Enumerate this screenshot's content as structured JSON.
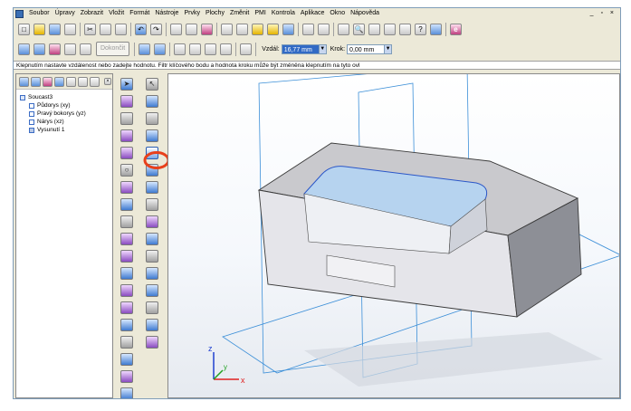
{
  "menu": {
    "items": [
      "Soubor",
      "Úpravy",
      "Zobrazit",
      "Vložit",
      "Formát",
      "Nástroje",
      "Prvky",
      "Plochy",
      "Změnit",
      "PMI",
      "Kontrola",
      "Aplikace",
      "Okno",
      "Nápověda"
    ],
    "window_controls": "_ ▫ ×"
  },
  "toolbar2": {
    "finish_label": "Dokončit",
    "distance_label": "Vzdál:",
    "distance_value": "16,77 mm",
    "step_label": "Krok:",
    "step_value": "0,00 mm"
  },
  "status_text": "Klepnutím nastavte vzdálenost nebo zadejte hodnotu. Filtr klíčového bodu a hodnota kroku může být změněna klepnutím na tyto ovl",
  "tree": {
    "root": "Soucast3",
    "children": [
      "Půdorys (xy)",
      "Pravý bokorys (yz)",
      "Nárys (xz)",
      "Vysunutí 1"
    ]
  },
  "triad": {
    "z": "z",
    "y": "y",
    "x": "x"
  },
  "colors": {
    "highlight_circle": "#e8401c",
    "plane_lines": "#3c8fd8",
    "axis_x": "#e02020",
    "axis_y": "#20a020",
    "axis_z": "#2040d0"
  },
  "icons": {
    "ribbon_left": [
      "arrow-select-icon",
      "smart-dimension-icon",
      "grid-icon",
      "plane-icon",
      "sketch-arrow-icon",
      "hole-icon",
      "fillet-icon",
      "shell-icon",
      "chamfer-icon",
      "draft-icon",
      "pattern-icon",
      "sphere-icon",
      "sweep-icon",
      "mirror-icon",
      "revolve-icon",
      "loft-icon",
      "thread-icon",
      "rib-icon",
      "part-icon",
      "assembly-icon"
    ],
    "ribbon_right": [
      "select-icon",
      "sketch-icon",
      "extrude-icon",
      "cut-icon",
      "coordinate-system-icon",
      "plane-on-face-icon",
      "rotate-icon",
      "offset-icon",
      "trim-icon",
      "extend-icon",
      "blend-icon",
      "thicken-icon",
      "split-icon",
      "face-icon",
      "body-icon",
      "delete-icon"
    ]
  }
}
